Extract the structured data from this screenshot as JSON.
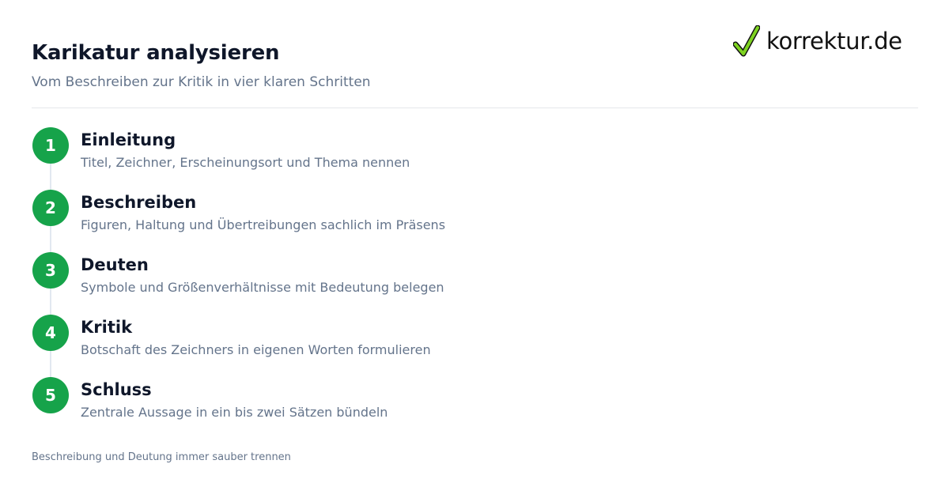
{
  "header": {
    "title": "Karikatur analysieren",
    "subtitle": "Vom Beschreiben zur Kritik in vier klaren Schritten"
  },
  "logo": {
    "text": "korrektur.de",
    "icon": "checkmark-icon",
    "accent_color": "#7ed321"
  },
  "colors": {
    "step_circle": "#16a34a",
    "title": "#0f172a",
    "muted": "#64748b",
    "divider": "#e5e7eb"
  },
  "steps": [
    {
      "number": "1",
      "title": "Einleitung",
      "description": "Titel, Zeichner, Erscheinungsort und Thema nennen"
    },
    {
      "number": "2",
      "title": "Beschreiben",
      "description": "Figuren, Haltung und Übertreibungen sachlich im Präsens"
    },
    {
      "number": "3",
      "title": "Deuten",
      "description": "Symbole und Größenverhältnisse mit Bedeutung belegen"
    },
    {
      "number": "4",
      "title": "Kritik",
      "description": "Botschaft des Zeichners in eigenen Worten formulieren"
    },
    {
      "number": "5",
      "title": "Schluss",
      "description": "Zentrale Aussage in ein bis zwei Sätzen bündeln"
    }
  ],
  "footer": {
    "note": "Beschreibung und Deutung immer sauber trennen"
  }
}
